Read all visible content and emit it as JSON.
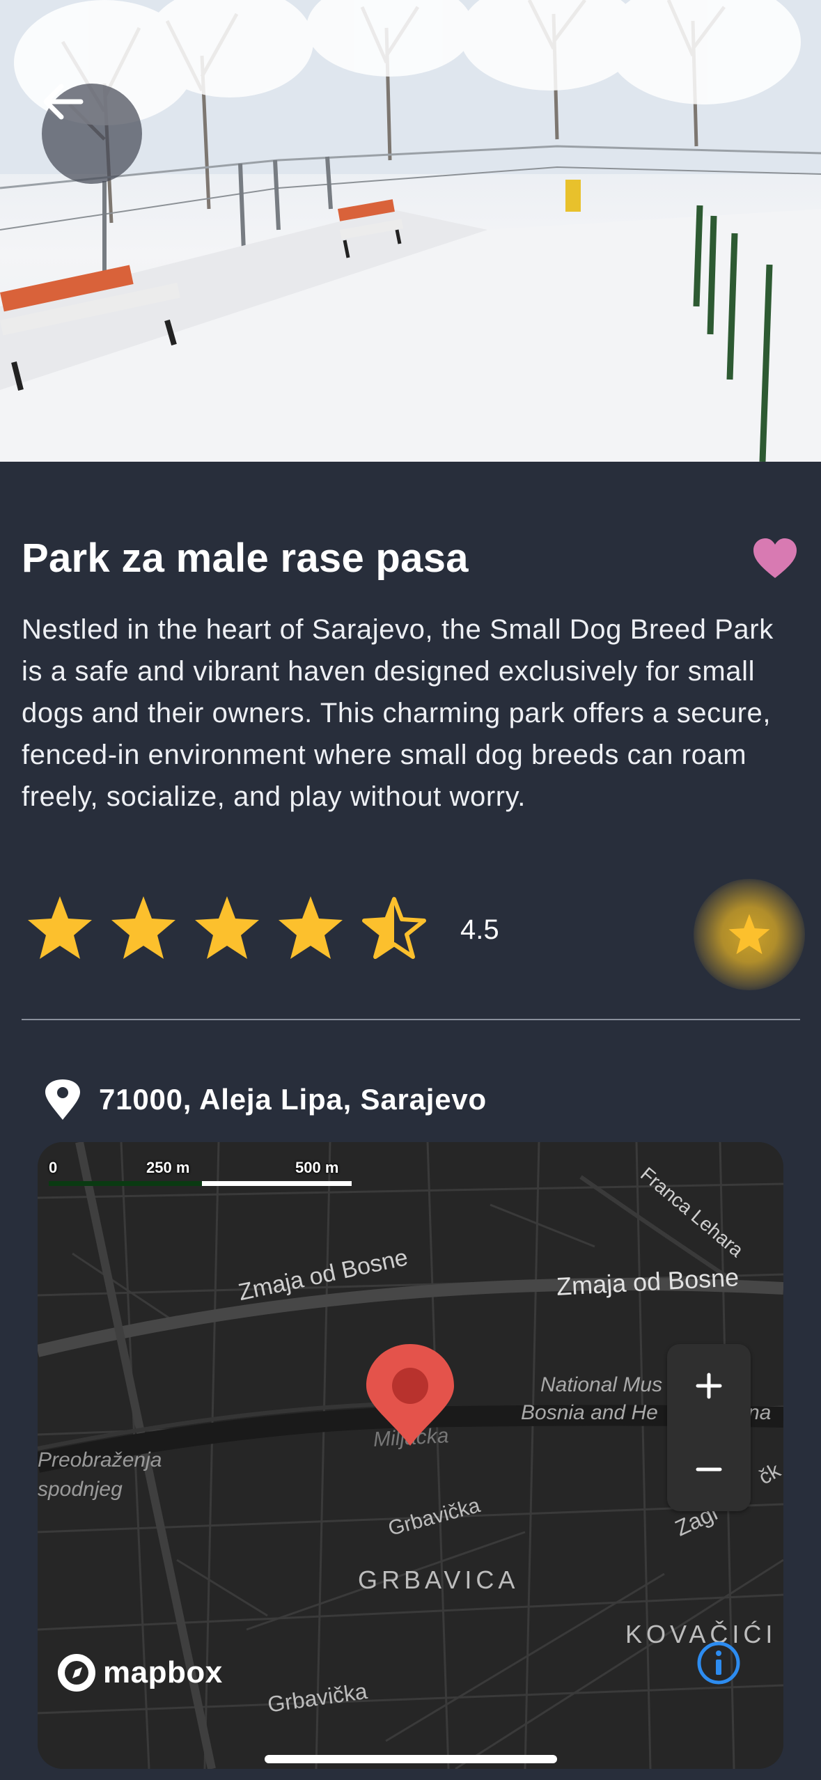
{
  "park": {
    "title": "Park za male rase pasa",
    "description": "Nestled in the heart of Sarajevo, the Small Dog Breed Park is a safe and vibrant haven designed exclusively for small dogs and their owners. This charming park offers a secure, fenced-in environment where small dog breeds can roam freely, socialize, and play without worry.",
    "rating": 4.5,
    "rating_label": "4.5",
    "address": "71000, Aleja Lipa, Sarajevo",
    "favorite_color": "#d87ab2"
  },
  "map": {
    "scale": {
      "zero": "0",
      "mid": "250 m",
      "max": "500 m"
    },
    "labels": {
      "street1": "Zmaja od Bosne",
      "street2": "Zmaja od Bosne",
      "street3": "Franca Lehara",
      "museum1": "National Mus",
      "museum2": "Bosnia and He",
      "museum_suffix": "na",
      "river": "Miljacka",
      "left1": "Preobraženja",
      "left2": "spodnjeg",
      "grbavicka1": "Grbavička",
      "grbavicka2": "Grbavička",
      "district": "GRBAVICA",
      "kovacici": "KOVAČIĆI",
      "zagreb": "Zagi",
      "cka": "čk"
    },
    "brand": "mapbox",
    "zoom_in": "+",
    "zoom_out": "−"
  },
  "colors": {
    "background": "#282e3b",
    "star": "#fcc02d",
    "pin": "#e4534b",
    "info": "#2d8cf0"
  }
}
